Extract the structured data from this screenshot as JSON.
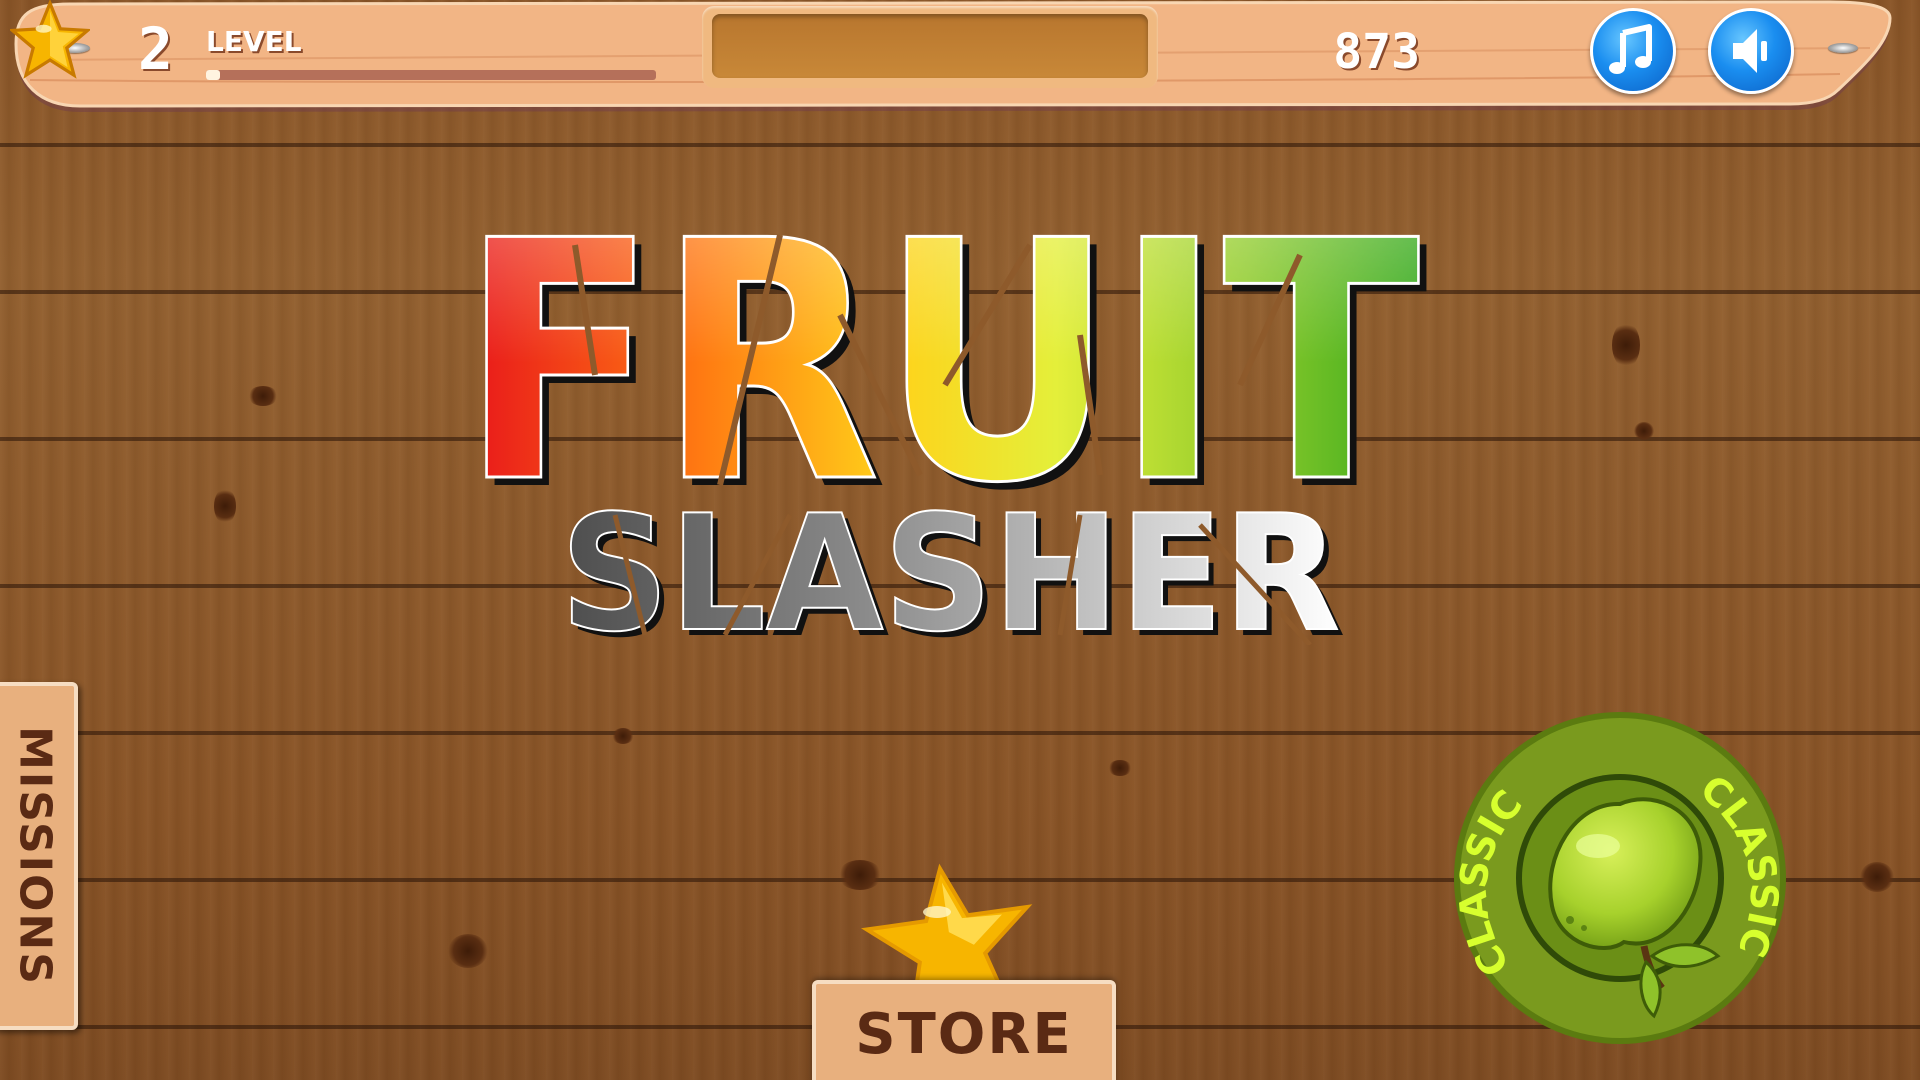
{
  "hud": {
    "level_number": "2",
    "level_label": "LEVEL",
    "level_progress": 0.03,
    "coins": "873"
  },
  "title": {
    "line1": "FRUIT",
    "line2": "SLASHER"
  },
  "missions": {
    "label": "MISSIONS"
  },
  "store": {
    "label": "STORE"
  },
  "classic": {
    "label": "CLASSIC"
  },
  "colors": {
    "wood": "#8e5a2b",
    "bar": "#f2b585",
    "button_blue": "#1a8ef0",
    "classic_green": "#a7d12c",
    "sign_text": "#5a2a14"
  },
  "icons": [
    "music-note-icon",
    "speaker-icon",
    "star-icon",
    "apple-icon"
  ]
}
